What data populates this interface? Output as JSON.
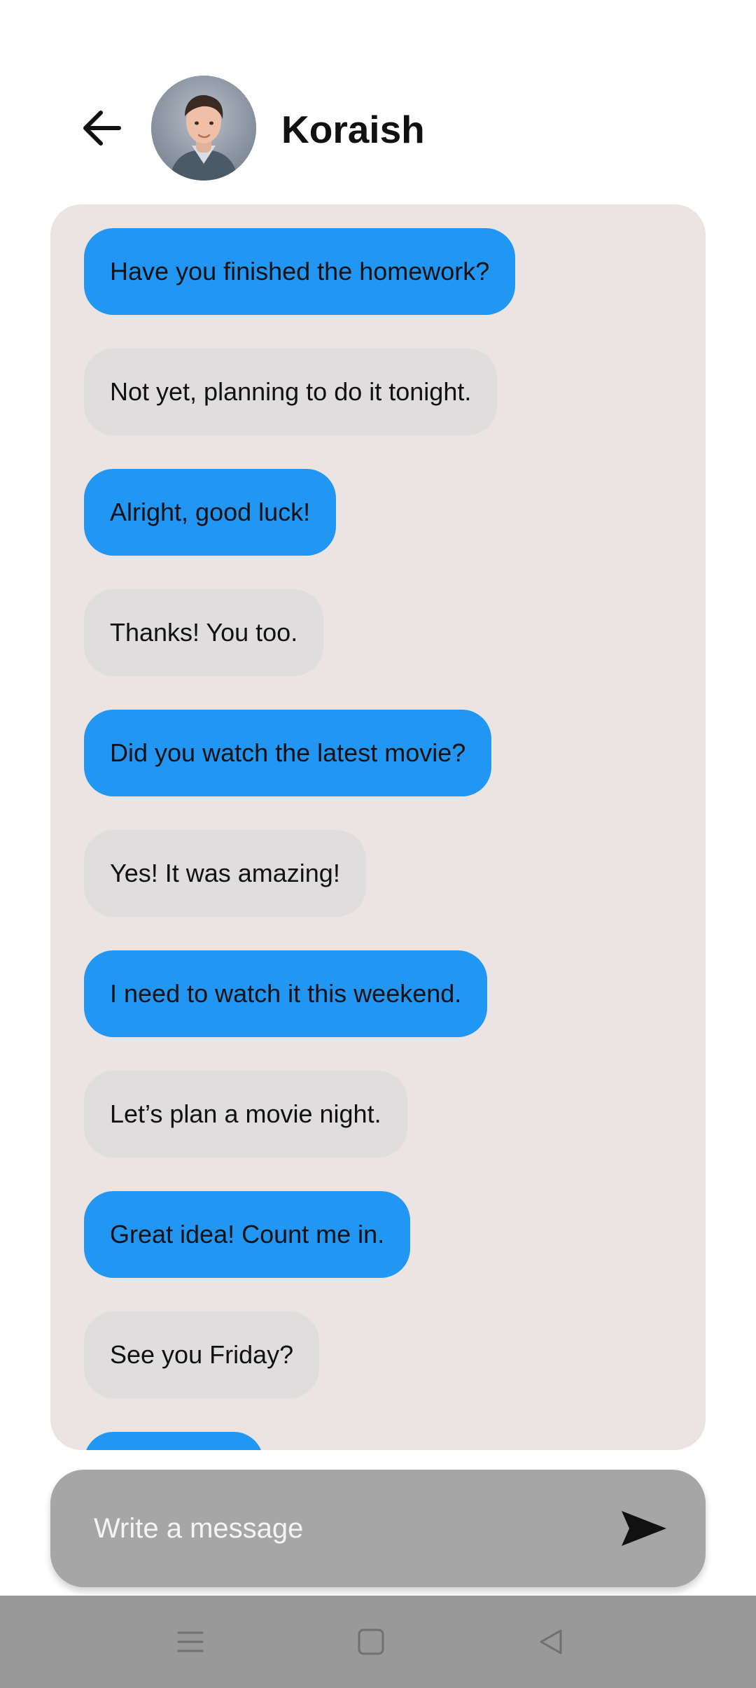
{
  "header": {
    "contact_name": "Koraish",
    "back_icon": "arrow-left-icon",
    "avatar": "contact-avatar"
  },
  "messages": [
    {
      "text": "Have you finished the homework?",
      "type": "sent"
    },
    {
      "text": "Not yet, planning to do it tonight.",
      "type": "received"
    },
    {
      "text": "Alright, good luck!",
      "type": "sent"
    },
    {
      "text": "Thanks! You too.",
      "type": "received"
    },
    {
      "text": "Did you watch the latest movie?",
      "type": "sent"
    },
    {
      "text": "Yes! It was amazing!",
      "type": "received"
    },
    {
      "text": "I need to watch it this weekend.",
      "type": "sent"
    },
    {
      "text": "Let’s plan a movie night.",
      "type": "received"
    },
    {
      "text": "Great idea! Count me in.",
      "type": "sent"
    },
    {
      "text": "See you Friday?",
      "type": "received"
    },
    {
      "text": "",
      "type": "sent"
    }
  ],
  "composer": {
    "placeholder": "Write a message",
    "value": "",
    "send_icon": "send-icon"
  },
  "nav": {
    "items": [
      "menu-icon",
      "home-icon",
      "back-triangle-icon"
    ]
  },
  "colors": {
    "sent_bubble": "#2196f3",
    "received_bubble": "#dfdddd",
    "chat_background": "#ebe4e3",
    "composer_background": "#a6a6a6",
    "nav_background": "#999999"
  }
}
